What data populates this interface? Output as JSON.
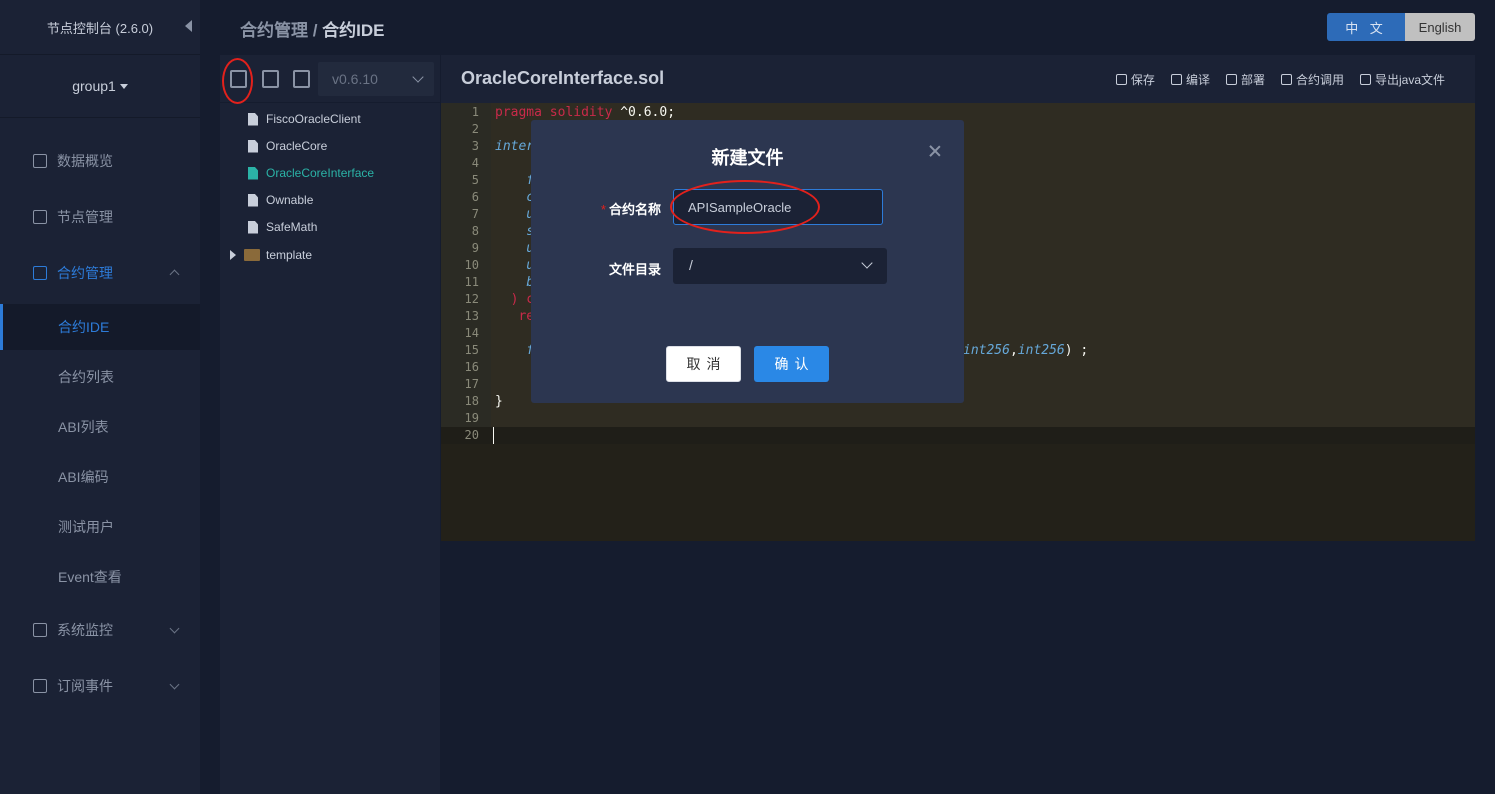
{
  "sidebar": {
    "title": "节点控制台 (2.6.0)",
    "group": "group1",
    "items": [
      {
        "label": "数据概览"
      },
      {
        "label": "节点管理"
      },
      {
        "label": "合约管理"
      },
      {
        "label": "系统监控"
      },
      {
        "label": "订阅事件"
      }
    ],
    "sub_items": [
      {
        "label": "合约IDE"
      },
      {
        "label": "合约列表"
      },
      {
        "label": "ABI列表"
      },
      {
        "label": "ABI编码"
      },
      {
        "label": "测试用户"
      },
      {
        "label": "Event查看"
      }
    ]
  },
  "header": {
    "breadcrumb_parent": "合约管理",
    "breadcrumb_sep": " / ",
    "breadcrumb_current": "合约IDE",
    "lang_zh": "中 文",
    "lang_en": "English"
  },
  "filepanel": {
    "version": "v0.6.10",
    "files": [
      "FiscoOracleClient",
      "OracleCore",
      "OracleCoreInterface",
      "Ownable",
      "SafeMath"
    ],
    "active_file": "OracleCoreInterface",
    "folder": "template"
  },
  "editor": {
    "filename": "OracleCoreInterface.sol",
    "actions": [
      "保存",
      "编译",
      "部署",
      "合约调用",
      "导出java文件"
    ],
    "line_numbers": [
      "1",
      "2",
      "3",
      "4",
      "5",
      "6",
      "7",
      "8",
      "9",
      "10",
      "11",
      "12",
      "13",
      "14",
      "15",
      "16",
      "17",
      "18",
      "19",
      "20"
    ],
    "line1_kw": "pragma solidity",
    "line1_rest": " ^0.6.0;",
    "line3": "inter",
    "line5": "    f",
    "line6": "    c",
    "line7": "    u",
    "line8": "    s",
    "line9": "    u",
    "line10": "    u",
    "line11": "    b",
    "line12": "  ) c",
    "line13": "   re",
    "line15_start": "    f",
    "line15_end_t1": "int256",
    "line15_comma": ",",
    "line15_end_t2": "int256",
    "line15_tail": ") ;",
    "line18": "}"
  },
  "modal": {
    "title": "新建文件",
    "name_label": "合约名称",
    "required_mark": "*",
    "name_value": "APISampleOracle",
    "dir_label": "文件目录",
    "dir_value": "/",
    "cancel": "取消",
    "confirm": "确认"
  }
}
